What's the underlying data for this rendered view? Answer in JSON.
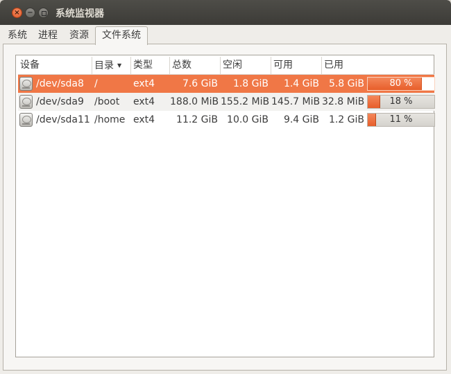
{
  "window": {
    "title": "系统监视器"
  },
  "tabs": [
    {
      "label": "系统",
      "active": false
    },
    {
      "label": "进程",
      "active": false
    },
    {
      "label": "资源",
      "active": false
    },
    {
      "label": "文件系统",
      "active": true
    }
  ],
  "columns": {
    "device": "设备",
    "directory": "目录",
    "type": "类型",
    "total": "总数",
    "free": "空闲",
    "available": "可用",
    "used": "已用"
  },
  "rows": [
    {
      "device": "/dev/sda8",
      "directory": "/",
      "type": "ext4",
      "total": "7.6 GiB",
      "free": "1.8 GiB",
      "available": "1.4 GiB",
      "used": "5.8 GiB",
      "percent_label": "80 %",
      "percent": 80,
      "selected": true
    },
    {
      "device": "/dev/sda9",
      "directory": "/boot",
      "type": "ext4",
      "total": "188.0 MiB",
      "free": "155.2 MiB",
      "available": "145.7 MiB",
      "used": "32.8 MiB",
      "percent_label": "18 %",
      "percent": 18,
      "selected": false
    },
    {
      "device": "/dev/sda11",
      "directory": "/home",
      "type": "ext4",
      "total": "11.2 GiB",
      "free": "10.0 GiB",
      "available": "9.4 GiB",
      "used": "1.2 GiB",
      "percent_label": "11 %",
      "percent": 11,
      "selected": false
    }
  ],
  "colors": {
    "accent": "#f07746",
    "titlebar": "#3c3b37",
    "bar_fill": "#e75e2a"
  },
  "icons": {
    "device": "harddisk-icon",
    "sort": "sort-descending-icon"
  }
}
